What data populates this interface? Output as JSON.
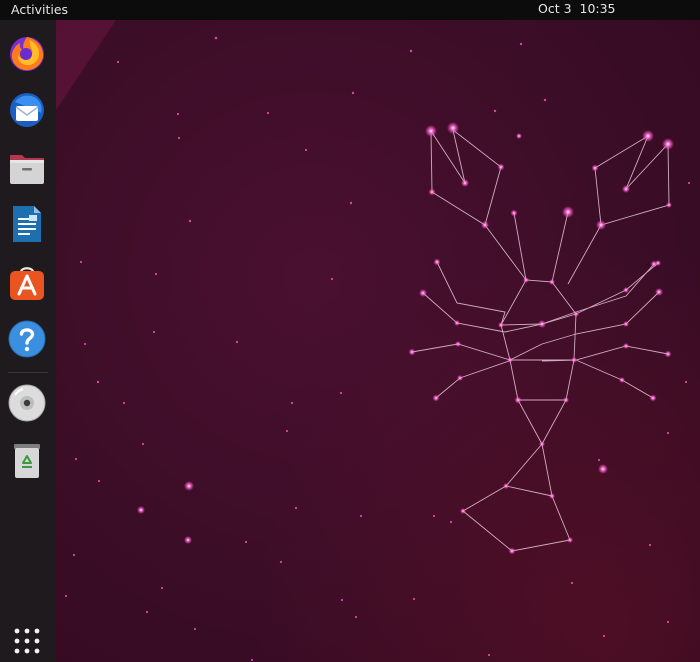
{
  "topbar": {
    "activities_label": "Activities",
    "clock": "Oct 3  10:35"
  },
  "dock": {
    "items": [
      {
        "name": "firefox",
        "icon": "firefox-icon"
      },
      {
        "name": "thunderbird",
        "icon": "thunderbird-icon"
      },
      {
        "name": "files",
        "icon": "files-icon"
      },
      {
        "name": "libreoffice-writer",
        "icon": "writer-icon"
      },
      {
        "name": "ubuntu-software",
        "icon": "software-icon"
      },
      {
        "name": "help",
        "icon": "help-icon"
      },
      {
        "name": "dvd-drive",
        "icon": "disc-icon"
      },
      {
        "name": "trash",
        "icon": "trash-icon"
      }
    ],
    "show_apps_icon": "app-grid-icon"
  },
  "desktop": {
    "wallpaper": "lobster-constellation",
    "colors": {
      "background": "#3c0d27",
      "star": "#ff5fd1",
      "line": "#e8c8dc",
      "dock": "#1f1a1d",
      "topbar": "#0c0c0c"
    }
  }
}
